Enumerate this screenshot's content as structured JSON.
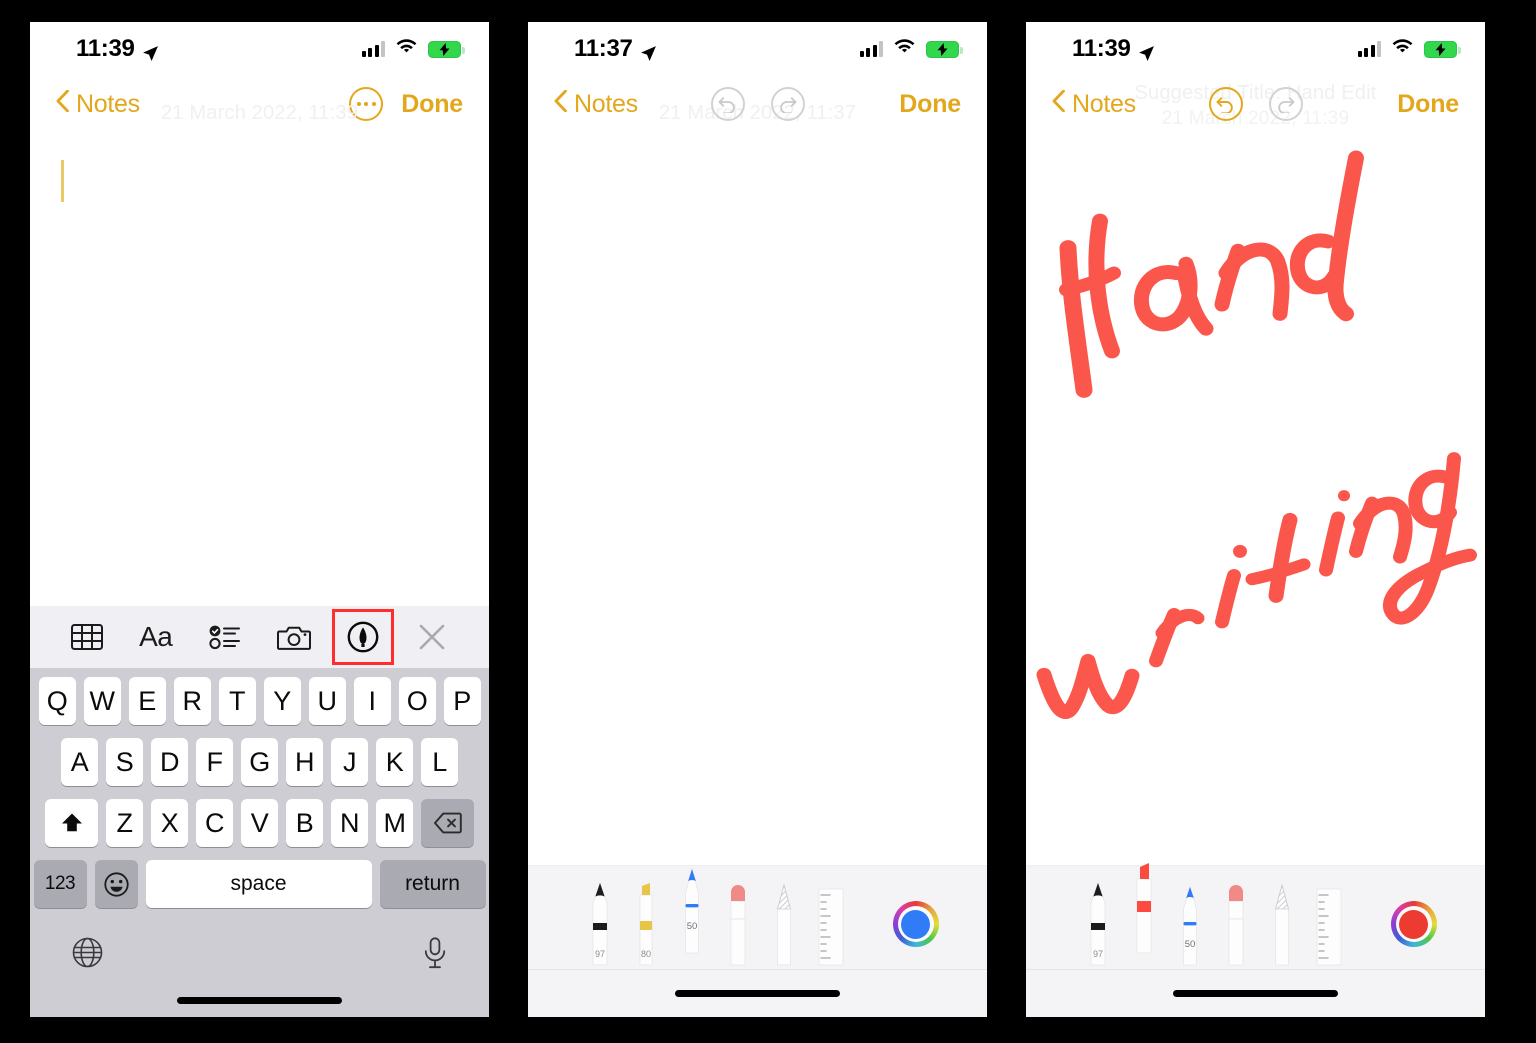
{
  "meta": {
    "app": "Notes",
    "platform": "iOS",
    "panel_count": 3
  },
  "colors": {
    "accent_yellow": "#e3a71c",
    "marker_red": "#fb4a3f",
    "keyboard_bg": "#cdcdd3",
    "toolbar_bg": "#f0eff4",
    "palette_bg": "#f4f4f6",
    "highlight_box": "#ff2d2d",
    "battery_green": "#32d74b",
    "pencil_blue": "#2f7cf6",
    "highlighter_yellow": "#e8c547",
    "eraser_pink": "#ef8a86"
  },
  "panels": [
    {
      "id": "panel-1",
      "status_bar": {
        "time": "11:39",
        "location_icon": "location-arrow-icon",
        "signal_icon": "cellular-signal-icon",
        "wifi_icon": "wifi-icon",
        "battery_icon": "battery-charging-icon"
      },
      "nav": {
        "back_label": "Notes",
        "back_icon": "chevron-left-icon",
        "done_label": "Done",
        "more_icon": "more-circle-icon",
        "ghost_date": "21 March 2022, 11:39"
      },
      "body": {
        "caret": true,
        "text": ""
      },
      "note_toolbar": {
        "items": [
          {
            "name": "table-icon",
            "label": "Table",
            "selected": false
          },
          {
            "name": "format-aa-icon",
            "label": "Aa",
            "selected": false
          },
          {
            "name": "checklist-icon",
            "label": "Checklist",
            "selected": false
          },
          {
            "name": "camera-icon",
            "label": "Camera",
            "selected": false
          },
          {
            "name": "markup-pen-icon",
            "label": "Markup",
            "selected": true
          },
          {
            "name": "close-x-icon",
            "label": "Close",
            "selected": false
          }
        ]
      },
      "keyboard": {
        "row1": [
          "Q",
          "W",
          "E",
          "R",
          "T",
          "Y",
          "U",
          "I",
          "O",
          "P"
        ],
        "row2": [
          "A",
          "S",
          "D",
          "F",
          "G",
          "H",
          "J",
          "K",
          "L"
        ],
        "row3": [
          "Z",
          "X",
          "C",
          "V",
          "B",
          "N",
          "M"
        ],
        "shift_icon": "shift-up-arrow-icon",
        "backspace_icon": "backspace-delete-icon",
        "numbers_label": "123",
        "emoji_icon": "emoji-smiley-icon",
        "space_label": "space",
        "return_label": "return",
        "globe_icon": "globe-language-icon",
        "mic_icon": "microphone-icon"
      }
    },
    {
      "id": "panel-2",
      "status_bar": {
        "time": "11:37",
        "location_icon": "location-arrow-icon",
        "signal_icon": "cellular-signal-icon",
        "wifi_icon": "wifi-icon",
        "battery_icon": "battery-charging-icon"
      },
      "nav": {
        "back_label": "Notes",
        "back_icon": "chevron-left-icon",
        "done_label": "Done",
        "undo_icon": "undo-arrow-icon",
        "redo_icon": "redo-arrow-icon",
        "undo_enabled": false,
        "redo_enabled": false,
        "ghost_date": "21 March 2022, 11:37"
      },
      "body": {
        "drawing": false
      },
      "palette": {
        "selected": "pencil",
        "tools": [
          {
            "name": "pen-tool",
            "label": "Pen",
            "value": "97",
            "color": "#1c1c1c",
            "selected": false
          },
          {
            "name": "highlighter-tool",
            "label": "Highlighter",
            "value": "80",
            "color": "#e8c547",
            "selected": false
          },
          {
            "name": "pencil-tool",
            "label": "Pencil",
            "value": "50",
            "color": "#2f7cf6",
            "selected": true
          },
          {
            "name": "eraser-tool",
            "label": "Eraser",
            "value": "",
            "color": "#ef8a86",
            "selected": false
          },
          {
            "name": "lasso-tool",
            "label": "Lasso",
            "value": "",
            "color": "#b8b8bc",
            "selected": false
          },
          {
            "name": "ruler-tool",
            "label": "Ruler",
            "value": "",
            "color": "#a8a8ac",
            "selected": false
          }
        ],
        "color_wheel": {
          "name": "color-wheel",
          "current_color": "#2f7cf6"
        }
      }
    },
    {
      "id": "panel-3",
      "status_bar": {
        "time": "11:39",
        "location_icon": "location-arrow-icon",
        "signal_icon": "cellular-signal-icon",
        "wifi_icon": "wifi-icon",
        "battery_icon": "battery-charging-icon"
      },
      "nav": {
        "back_label": "Notes",
        "back_icon": "chevron-left-icon",
        "done_label": "Done",
        "undo_icon": "undo-arrow-icon",
        "redo_icon": "redo-arrow-icon",
        "undo_enabled": true,
        "redo_enabled": false,
        "ghost_title": "Suggested Title: Hand    Edit",
        "ghost_date": "21 March 2022, 11:39"
      },
      "body": {
        "drawing": true,
        "drawing_text": "Hand writing",
        "drawing_color": "#fb4a3f",
        "drawing_description": "Red marker handwriting reading 'Hand' on upper line and 'writing' on lower line, slanted upward"
      },
      "palette": {
        "selected": "highlighter",
        "tools": [
          {
            "name": "pen-tool",
            "label": "Pen",
            "value": "97",
            "color": "#1c1c1c",
            "selected": false
          },
          {
            "name": "highlighter-tool",
            "label": "Highlighter",
            "value": "",
            "color": "#fb4a3f",
            "selected": true
          },
          {
            "name": "pencil-tool",
            "label": "Pencil",
            "value": "50",
            "color": "#2f7cf6",
            "selected": false
          },
          {
            "name": "eraser-tool",
            "label": "Eraser",
            "value": "",
            "color": "#ef8a86",
            "selected": false
          },
          {
            "name": "lasso-tool",
            "label": "Lasso",
            "value": "",
            "color": "#b8b8bc",
            "selected": false
          },
          {
            "name": "ruler-tool",
            "label": "Ruler",
            "value": "",
            "color": "#a8a8ac",
            "selected": false
          }
        ],
        "color_wheel": {
          "name": "color-wheel",
          "current_color": "#ec3b30"
        }
      }
    }
  ]
}
